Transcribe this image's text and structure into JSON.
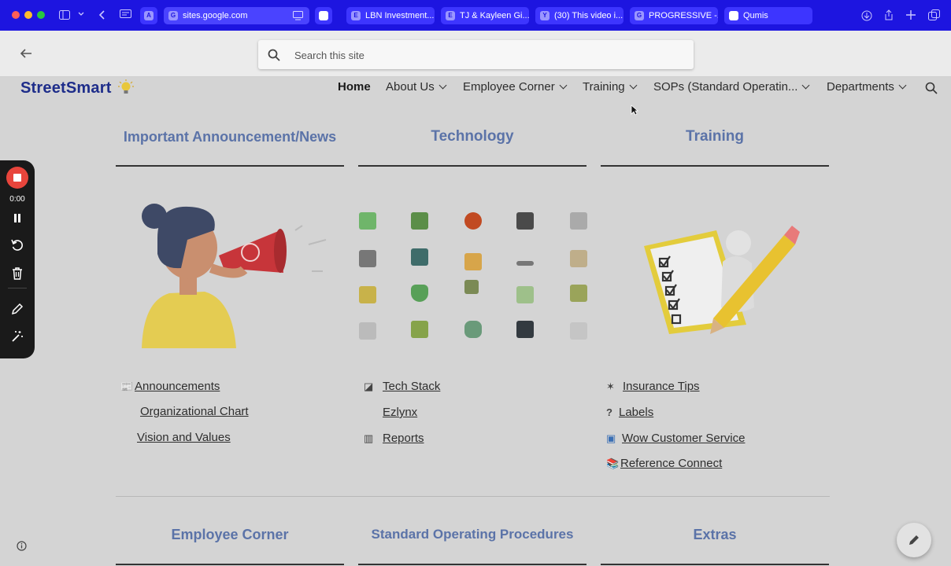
{
  "browser": {
    "tabs": [
      {
        "favicon": "A",
        "title": ""
      },
      {
        "favicon": "G",
        "title": "sites.google.com"
      },
      {
        "favicon": "",
        "title": ""
      },
      {
        "favicon": "E",
        "title": "LBN Investment..."
      },
      {
        "favicon": "E",
        "title": "TJ & Kayleen Gi..."
      },
      {
        "favicon": "Y",
        "title": "(30) This video i..."
      },
      {
        "favicon": "G",
        "title": "PROGRESSIVE -..."
      },
      {
        "favicon": "",
        "title": "Qumis"
      }
    ]
  },
  "search": {
    "placeholder": "Search this site"
  },
  "site": {
    "logo": "StreetSmart",
    "nav": [
      {
        "label": "Home",
        "has_menu": false
      },
      {
        "label": "About Us",
        "has_menu": true
      },
      {
        "label": "Employee Corner",
        "has_menu": true
      },
      {
        "label": "Training",
        "has_menu": true
      },
      {
        "label": "SOPs (Standard Operatin...",
        "has_menu": true
      },
      {
        "label": "Departments",
        "has_menu": true
      }
    ]
  },
  "columns": [
    {
      "heading": "Important Announcement/News",
      "links": [
        {
          "icon": "newspaper-icon",
          "label": "Announcements"
        },
        {
          "icon": "",
          "label": "Organizational Chart"
        },
        {
          "icon": "",
          "label": "Vision and Values "
        }
      ]
    },
    {
      "heading": "Technology",
      "links": [
        {
          "icon": "tablet-icon",
          "label": "Tech Stack"
        },
        {
          "icon": "",
          "label": "Ezlynx"
        },
        {
          "icon": "bar-chart-icon",
          "label": "Reports"
        }
      ]
    },
    {
      "heading": "Training",
      "links": [
        {
          "icon": "person-icon",
          "label": "Insurance Tips"
        },
        {
          "icon": "question-icon",
          "label": "Labels"
        },
        {
          "icon": "sparkle-icon",
          "label": "Wow Customer Service"
        },
        {
          "icon": "books-icon",
          "label": "Reference Connect"
        }
      ]
    }
  ],
  "bottom_headings": [
    "Employee Corner",
    "Standard Operating Procedures",
    "Extras"
  ],
  "recorder": {
    "time": "0:00"
  },
  "colors": {
    "tabbar": "#1d15e0",
    "heading": "#5b73a8",
    "logo": "#1e2d8a",
    "record": "#e8453c"
  }
}
